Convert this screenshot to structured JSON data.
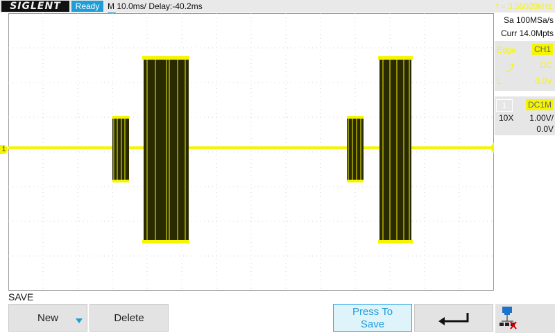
{
  "header": {
    "logo": "SIGLENT",
    "status": "Ready",
    "timebase": "M 10.0ms/ Delay:-40.2ms",
    "frequency": "f = 3.55020kHz"
  },
  "acquisition": {
    "sample_rate": "Sa 100MSa/s",
    "memory": "Curr 14.0Mpts"
  },
  "trigger": {
    "edge_label": "Edge",
    "source": "CH1",
    "slope_symbol": "⤴",
    "coupling": "DC",
    "level_symbol": "L",
    "level": "0.0V"
  },
  "channel1": {
    "number": "1",
    "coupling": "DC1M",
    "probe": "10X",
    "scale": "1.00V/",
    "offset": "0.0V",
    "marker": "1"
  },
  "menu": {
    "title": "SAVE",
    "new_label": "New",
    "delete_label": "Delete",
    "press_to_save_line1": "Press To",
    "press_to_save_line2": "Save"
  },
  "colors": {
    "trace": "#f5f500",
    "accent": "#1e9ed8",
    "fill": "#2a2a00"
  },
  "icons": {
    "back": "back-arrow-icon",
    "network": "network-icon",
    "new_dropdown": "arrow-down-icon"
  }
}
